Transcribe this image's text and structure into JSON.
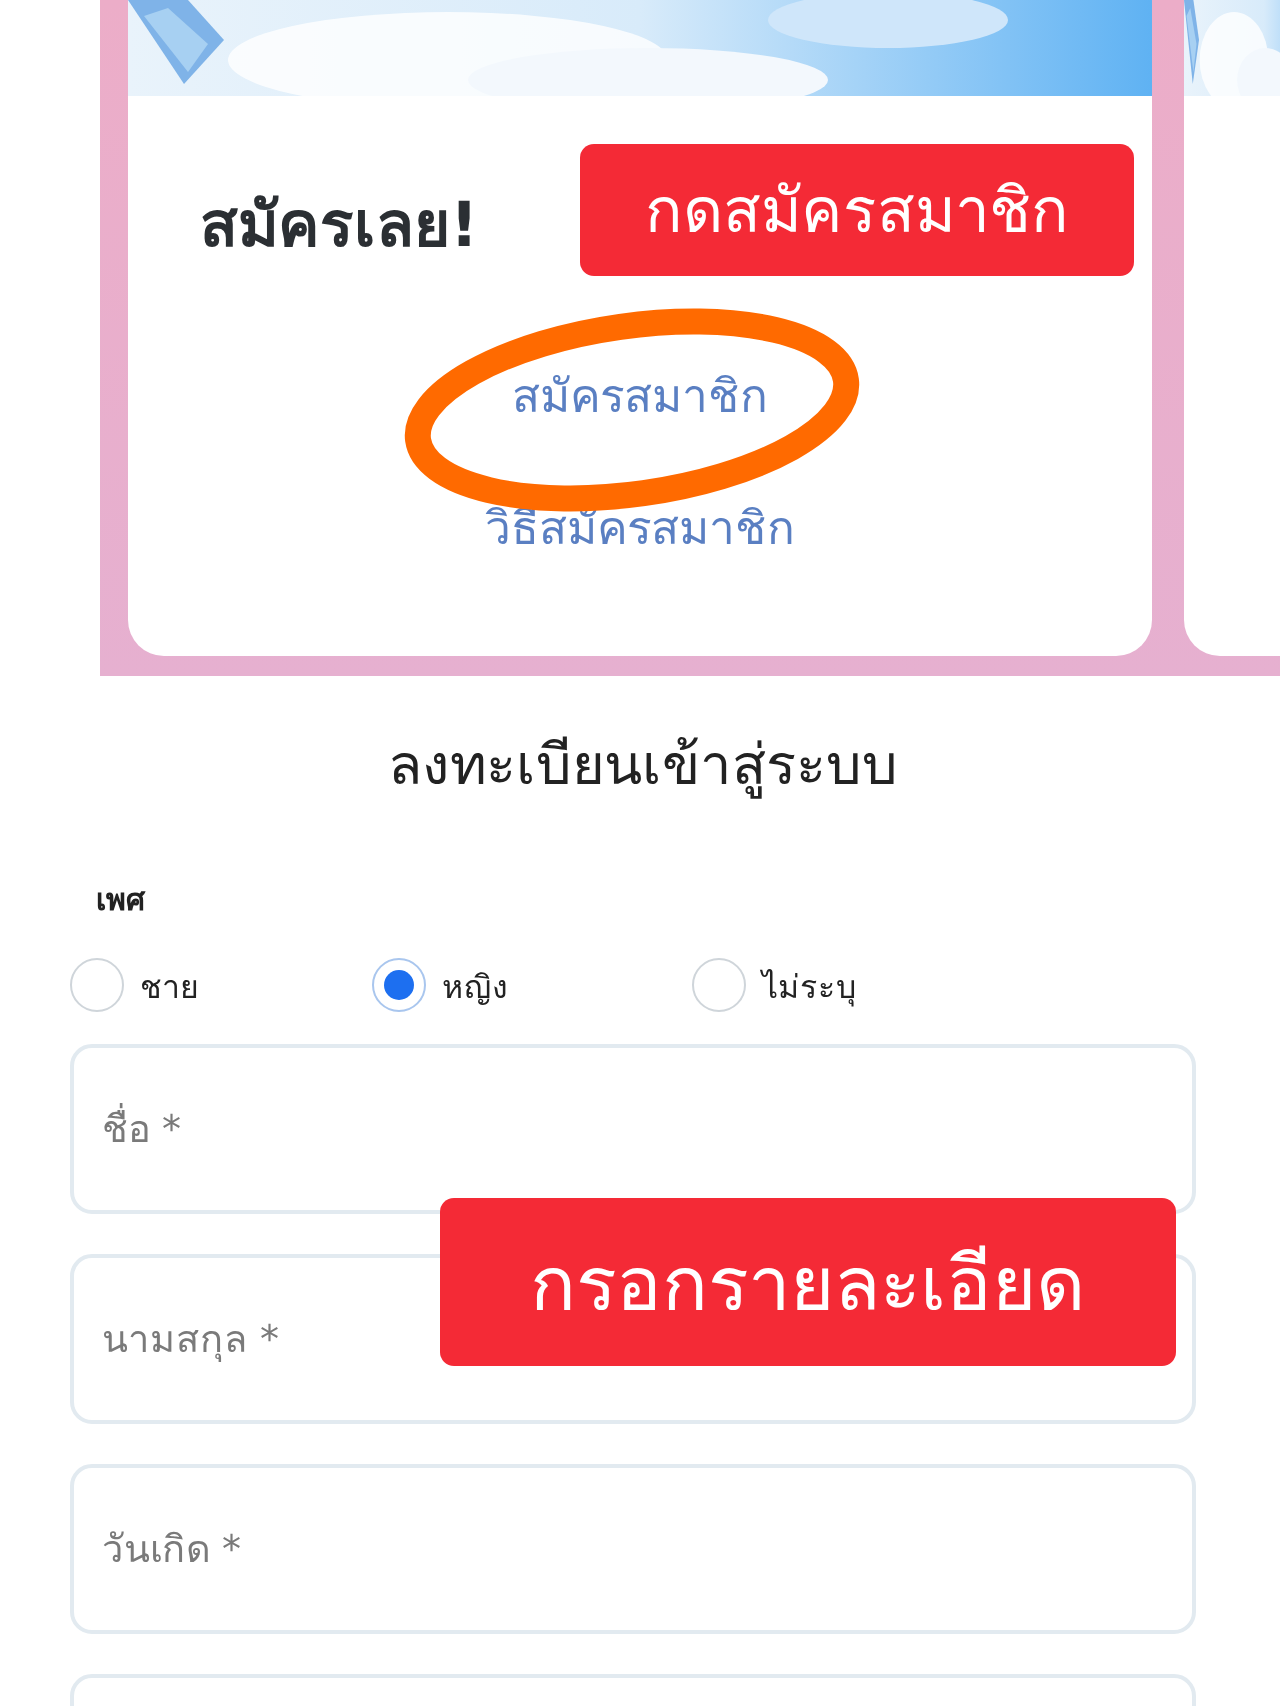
{
  "promo_strip": {
    "signup_card": {
      "banner": {
        "kind": "picture"
      },
      "heading": "สมัครเลย!",
      "links": [
        "สมัครสมาชิก",
        "วิธีสมัครสมาชิก"
      ]
    },
    "next_card": {
      "banner": {
        "kind": "picture"
      }
    }
  },
  "form": {
    "title": "ลงทะเบียนเข้าสู่ระบบ",
    "gender": {
      "label": "เพศ",
      "options": [
        {
          "label": "ชาย",
          "selected": false
        },
        {
          "label": "หญิง",
          "selected": true
        },
        {
          "label": "ไม่ระบุ",
          "selected": false
        }
      ]
    },
    "fields": [
      {
        "kind": "text",
        "placeholder": "ชื่อ *"
      },
      {
        "kind": "text",
        "placeholder": "นามสกุล *"
      },
      {
        "kind": "text",
        "placeholder": "วันเกิด *"
      },
      {
        "kind": "text"
      }
    ]
  },
  "annotations": [
    {
      "kind": "label",
      "text": "กดสมัครสมาชิก"
    },
    {
      "kind": "circle"
    },
    {
      "kind": "label",
      "text": "กรอกรายละเอียด"
    }
  ]
}
